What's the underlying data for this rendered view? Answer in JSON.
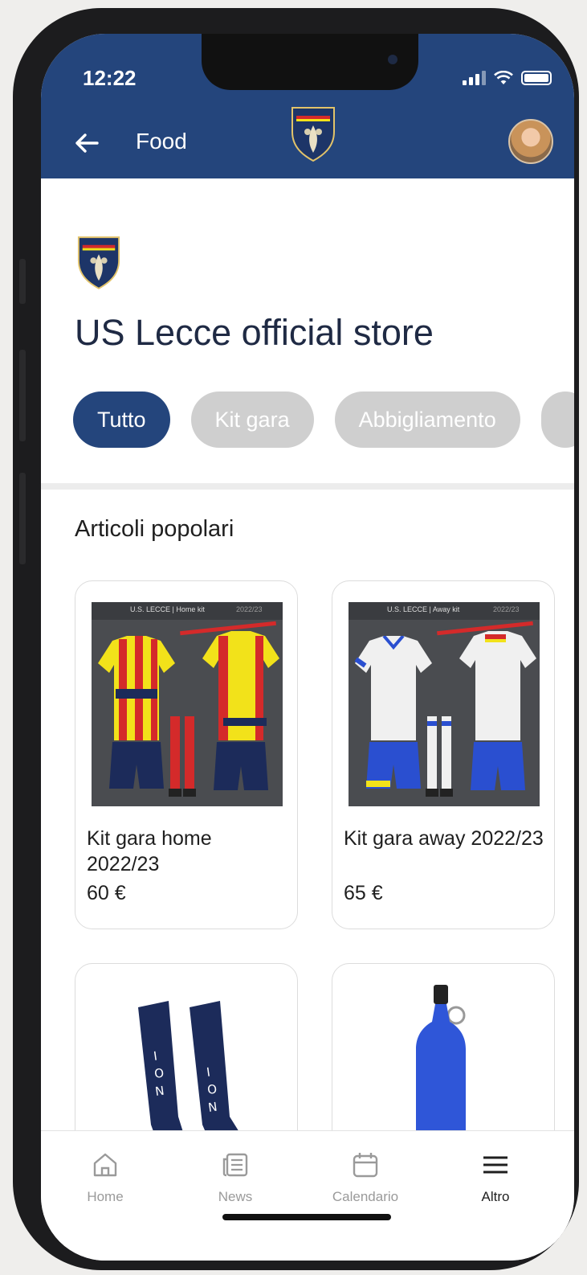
{
  "status": {
    "time": "12:22"
  },
  "header": {
    "title": "Food"
  },
  "store": {
    "title": "US Lecce official store"
  },
  "chips": [
    "Tutto",
    "Kit gara",
    "Abbigliamento",
    ""
  ],
  "section": {
    "title": "Articoli popolari"
  },
  "products": [
    {
      "name": "Kit gara home 2022/23",
      "price": "60 €",
      "image_caption": "U.S. LECCE | Home kit",
      "image_season": "2022/23"
    },
    {
      "name": "Kit gara away 2022/23",
      "price": "65 €",
      "image_caption": "U.S. LECCE | Away kit",
      "image_season": "2022/23"
    },
    {
      "name": "",
      "price": ""
    },
    {
      "name": "",
      "price": ""
    }
  ],
  "nav": [
    {
      "label": "Home",
      "icon": "home-icon"
    },
    {
      "label": "News",
      "icon": "news-icon"
    },
    {
      "label": "Calendario",
      "icon": "calendar-icon"
    },
    {
      "label": "Altro",
      "icon": "menu-icon"
    }
  ],
  "colors": {
    "brand": "#24457c",
    "chip_inactive": "#cfcfcf",
    "kit_red": "#d42a2a",
    "kit_yellow": "#f2e21a",
    "kit_navy": "#1c2b5a",
    "bottle_blue": "#2f56d8"
  }
}
